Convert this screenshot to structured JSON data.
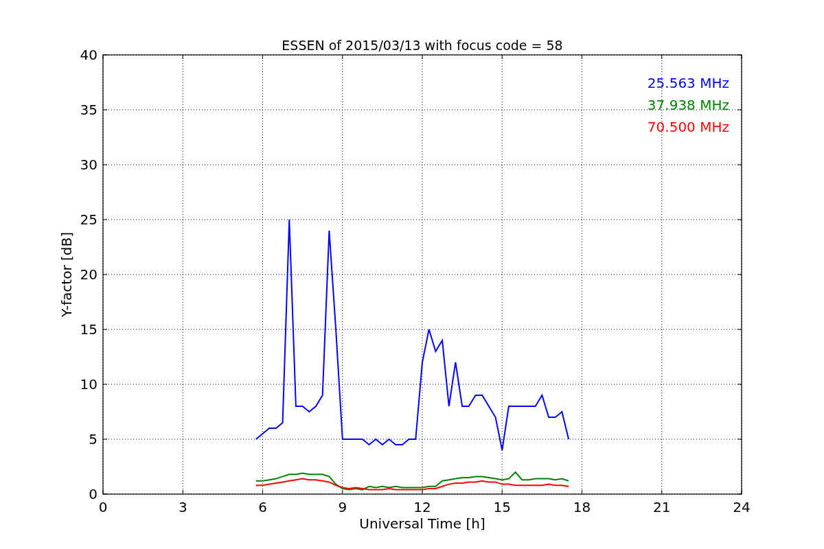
{
  "chart_data": {
    "type": "line",
    "title": "ESSEN of 2015/03/13 with focus code = 58",
    "xlabel": "Universal Time [h]",
    "ylabel": "Y-factor [dB]",
    "x": [
      5.75,
      6,
      6.25,
      6.5,
      6.75,
      7,
      7.25,
      7.5,
      7.75,
      8,
      8.25,
      8.5,
      8.75,
      9,
      9.25,
      9.5,
      9.75,
      10,
      10.25,
      10.5,
      10.75,
      11,
      11.25,
      11.5,
      11.75,
      12,
      12.25,
      12.5,
      12.75,
      13,
      13.25,
      13.5,
      13.75,
      14,
      14.25,
      14.5,
      14.75,
      15,
      15.25,
      15.5,
      15.75,
      16,
      16.25,
      16.5,
      16.75,
      17,
      17.25,
      17.5
    ],
    "series": [
      {
        "name": "25.563 MHz",
        "color": "#0000ff",
        "values": [
          5,
          5.5,
          6,
          6,
          6.5,
          25,
          8,
          8,
          7.5,
          8,
          9,
          24,
          15,
          5,
          5,
          5,
          5,
          4.5,
          5,
          4.5,
          5,
          4.5,
          4.5,
          5,
          5,
          12,
          15,
          13,
          14,
          8,
          12,
          8,
          8,
          9,
          9,
          8,
          7,
          4,
          8,
          8,
          8,
          8,
          8,
          9,
          7,
          7,
          7.5,
          5
        ]
      },
      {
        "name": "37.938 MHz",
        "color": "#008000",
        "values": [
          1.2,
          1.2,
          1.3,
          1.4,
          1.6,
          1.8,
          1.8,
          1.9,
          1.8,
          1.8,
          1.8,
          1.6,
          0.9,
          0.5,
          0.4,
          0.5,
          0.4,
          0.7,
          0.6,
          0.7,
          0.6,
          0.7,
          0.6,
          0.6,
          0.6,
          0.6,
          0.7,
          0.7,
          1.2,
          1.3,
          1.4,
          1.5,
          1.5,
          1.6,
          1.6,
          1.5,
          1.4,
          1.3,
          1.4,
          2,
          1.3,
          1.3,
          1.4,
          1.4,
          1.4,
          1.3,
          1.4,
          1.2
        ]
      },
      {
        "name": "70.500 MHz",
        "color": "#ff0000",
        "values": [
          0.8,
          0.8,
          0.9,
          1,
          1.1,
          1.2,
          1.3,
          1.4,
          1.3,
          1.3,
          1.2,
          1.1,
          0.8,
          0.6,
          0.5,
          0.6,
          0.5,
          0.4,
          0.4,
          0.4,
          0.5,
          0.4,
          0.4,
          0.4,
          0.4,
          0.4,
          0.5,
          0.5,
          0.7,
          0.9,
          1,
          1,
          1.1,
          1.1,
          1.2,
          1.1,
          1.1,
          0.9,
          0.9,
          0.8,
          0.8,
          0.8,
          0.8,
          0.8,
          0.9,
          0.8,
          0.8,
          0.7
        ]
      }
    ],
    "grid": true,
    "xlim": [
      0,
      24
    ],
    "ylim": [
      0,
      40
    ],
    "xticks": [
      0,
      3,
      6,
      9,
      12,
      15,
      18,
      21,
      24
    ],
    "yticks": [
      0,
      5,
      10,
      15,
      20,
      25,
      30,
      35,
      40
    ]
  }
}
